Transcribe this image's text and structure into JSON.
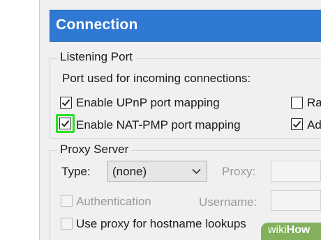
{
  "header": {
    "title": "Connection"
  },
  "listening_port": {
    "group_title": "Listening Port",
    "description": "Port used for incoming connections:",
    "upnp": {
      "label": "Enable UPnP port mapping",
      "checked": true
    },
    "natpmp": {
      "label": "Enable NAT-PMP port mapping",
      "checked": true
    },
    "right_option_1": {
      "label": "Ra",
      "checked": false
    },
    "right_option_2": {
      "label": "Ad",
      "checked": true
    }
  },
  "proxy_server": {
    "group_title": "Proxy Server",
    "type_label": "Type:",
    "type_value": "(none)",
    "proxy_label": "Proxy:",
    "authentication": {
      "label": "Authentication",
      "checked": false
    },
    "username_label": "Username:",
    "hostname_lookups": {
      "label": "Use proxy for hostname lookups",
      "checked": false
    }
  },
  "watermark": {
    "part1": "wiki",
    "part2": "How"
  },
  "colors": {
    "header_bg": "#2f78d4",
    "highlight": "#26e026",
    "watermark_bg": "#78aa50"
  }
}
